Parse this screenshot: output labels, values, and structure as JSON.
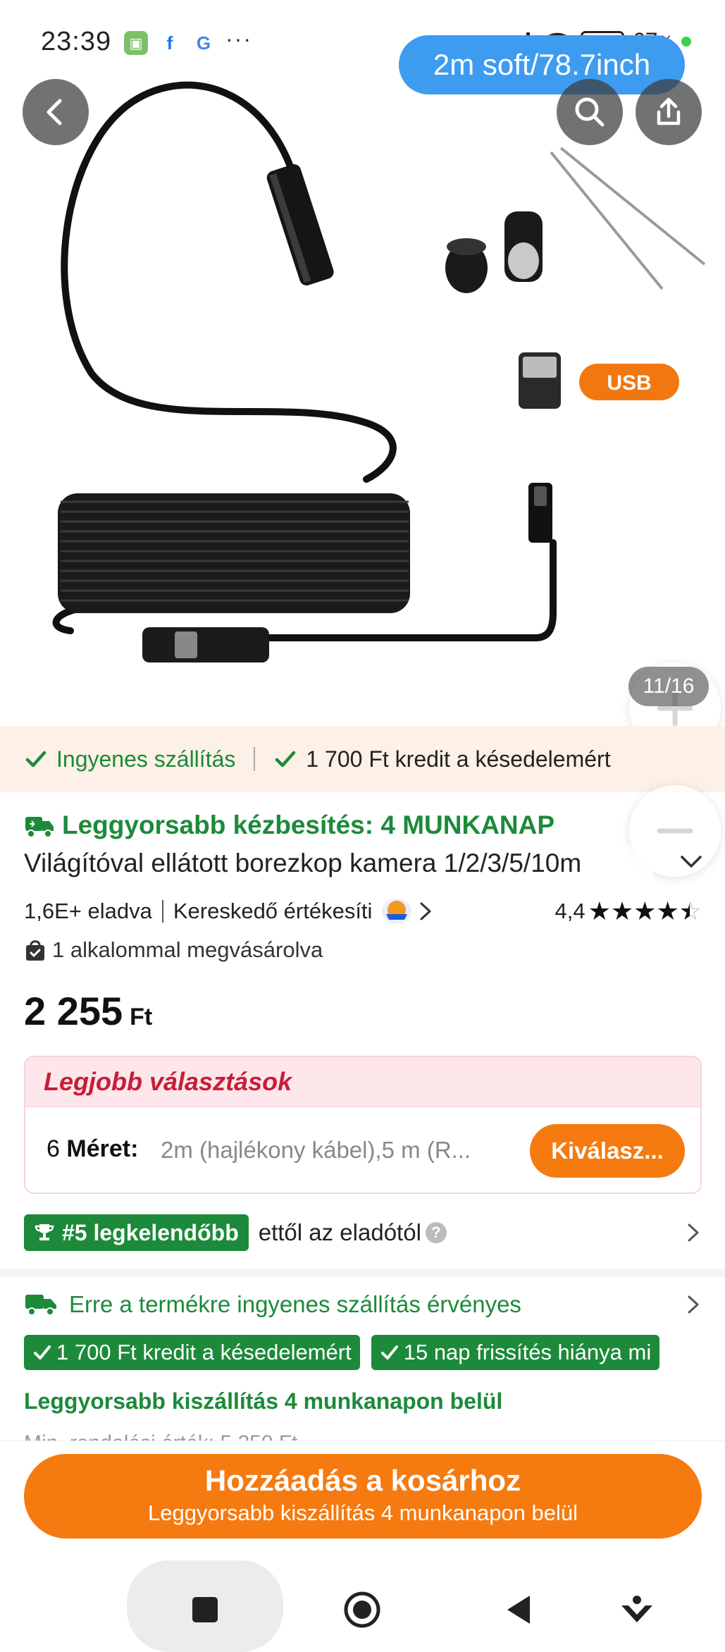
{
  "status_bar": {
    "time": "23:39",
    "dots": "···",
    "battery": "67",
    "battery_unit": "%"
  },
  "gallery": {
    "variant_label": "2m soft/78.7inch",
    "image_counter": "11/16",
    "usb_label": "USB"
  },
  "benefits": {
    "free_shipping": "Ingyenes szállítás",
    "late_credit": "1 700 Ft kredit a késedelemért"
  },
  "product": {
    "delivery_headline": "Leggyorsabb kézbesítés: 4 MUNKANAP",
    "title": "Világítóval ellátott borezkop kamera 1/2/3/5/10m",
    "sold": "1,6E+ eladva",
    "seller_label": "Kereskedő értékesíti",
    "rating": "4,4",
    "rating_value": 4.4,
    "bought_times": "1 alkalommal megvásárolva",
    "price_amount": "2 255",
    "price_currency": "Ft"
  },
  "best_picks": {
    "title": "Legjobb választások",
    "size_count": "6",
    "size_label": "Méret:",
    "size_value": "2m (hajlékony kábel),5 m (R...",
    "choose_button": "Kiválasz..."
  },
  "bestseller": {
    "badge": "#5 legkelendőbb",
    "text": "ettől az eladótól",
    "help": "?"
  },
  "shipping": {
    "free_shipping_line": "Erre a termékre ingyenes szállítás érvényes",
    "tags": [
      "1 700 Ft kredit a késedelemért",
      "15 nap frissítés hiánya mi"
    ],
    "fast_delivery": "Leggyorsabb kiszállítás 4 munkanapon belül",
    "min_order": "Min. rendelési érték: 5 250 Ft"
  },
  "cta": {
    "main": "Hozzáadás a kosárhoz",
    "sub": "Leggyorsabb kiszállítás 4 munkanapon belül"
  },
  "colors": {
    "accent_orange": "#f57a10",
    "success_green": "#1c8a3a",
    "pill_blue": "#3d9bf0",
    "picks_red": "#c81d3a"
  }
}
